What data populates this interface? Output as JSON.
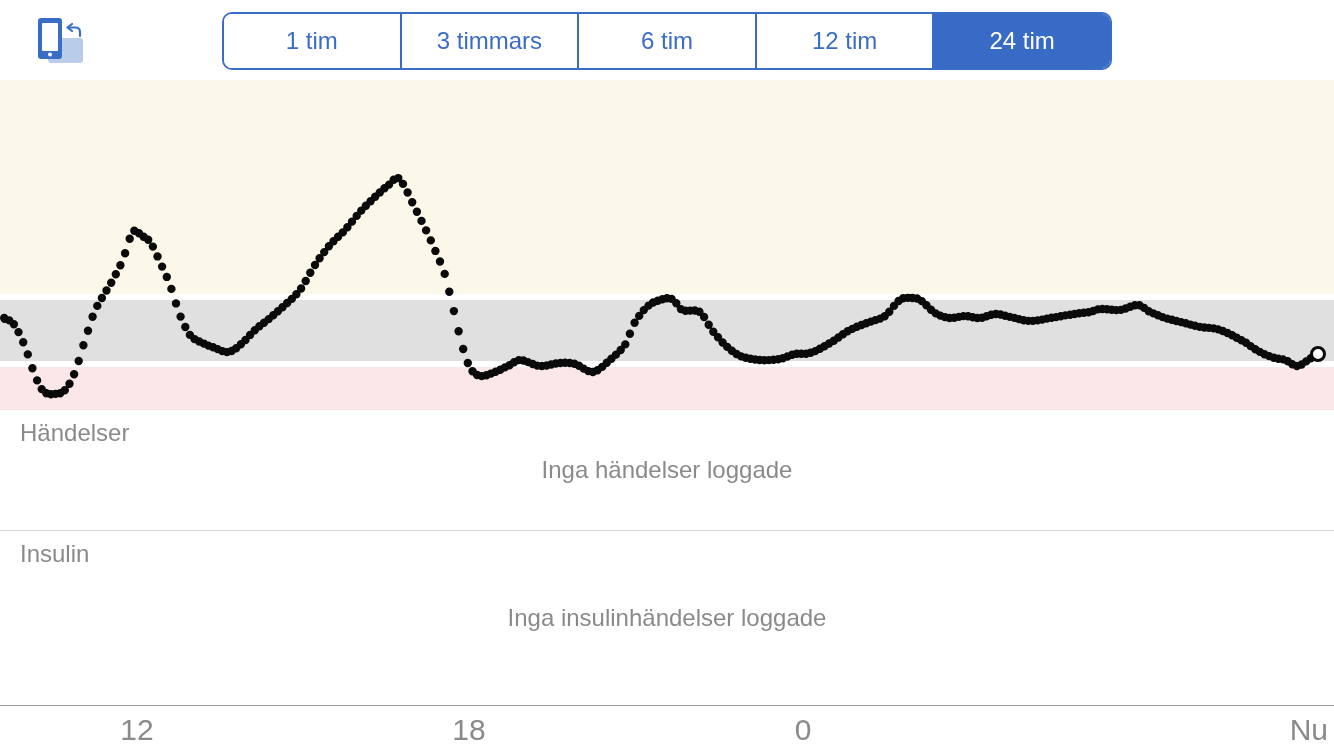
{
  "toolbar": {
    "range_tabs": [
      {
        "label": "1 tim",
        "selected": false
      },
      {
        "label": "3 timmars",
        "selected": false
      },
      {
        "label": "6 tim",
        "selected": false
      },
      {
        "label": "12 tim",
        "selected": false
      },
      {
        "label": "24 tim",
        "selected": true
      }
    ]
  },
  "sections": [
    {
      "title": "Händelser",
      "empty_text": "Inga händelser loggade"
    },
    {
      "title": "Insulin",
      "empty_text": "Inga insulinhändelser loggade"
    }
  ],
  "time_axis": [
    {
      "label": "12",
      "kind": "hour"
    },
    {
      "label": "18",
      "kind": "hour"
    },
    {
      "label": "0",
      "kind": "hour"
    },
    {
      "label": "Nu",
      "kind": "now"
    }
  ]
}
